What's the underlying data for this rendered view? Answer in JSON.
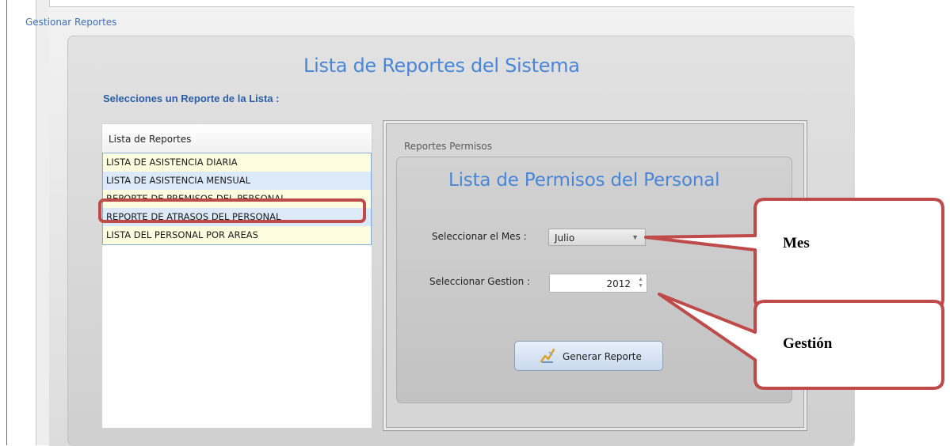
{
  "window": {
    "title": "Gestionar Reportes"
  },
  "main": {
    "title": "Lista  de Reportes del Sistema",
    "subtitle": "Selecciones un Reporte de la Lista :"
  },
  "report_list": {
    "header": "Lista de Reportes",
    "items": [
      "LISTA DE ASISTENCIA DIARIA",
      "LISTA DE ASISTENCIA MENSUAL",
      "REPORTE DE PREMISOS DEL PERSONAL",
      "REPORTE DE ATRASOS DEL PERSONAL",
      "LISTA DEL PERSONAL POR AREAS"
    ],
    "highlighted_index": 2
  },
  "permisos_panel": {
    "title": "Reportes Permisos",
    "heading": "Lista  de Permisos del Personal",
    "month_label": "Seleccionar el Mes :",
    "month_value": "Julio",
    "year_label": "Seleccionar  Gestion :",
    "year_value": "2012",
    "generate_button": "Generar Reporte"
  },
  "callouts": {
    "month": "Mes",
    "year": "Gestión"
  },
  "colors": {
    "accent_blue": "#4a86d8",
    "callout_red": "#bf4a4a",
    "row_yellow": "#fffde0",
    "row_blue": "#dce9f8"
  }
}
